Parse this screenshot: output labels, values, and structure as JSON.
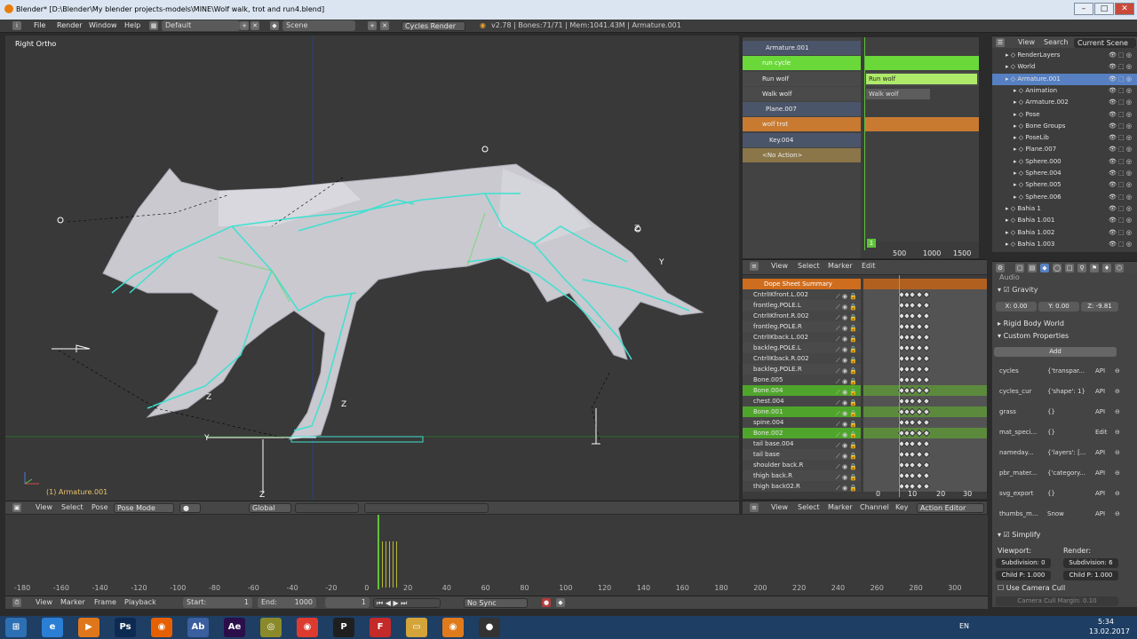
{
  "window": {
    "title": "Blender* [D:\\Blender\\My blender projects-models\\MINE\\Wolf walk, trot and run4.blend]"
  },
  "infobar": {
    "menus": [
      "File",
      "Render",
      "Window",
      "Help"
    ],
    "screen_layout": "Default",
    "scene": "Scene",
    "engine": "Cycles Render",
    "stats": "v2.78 | Bones:71/71 | Mem:1041.43M | Armature.001"
  },
  "viewport": {
    "view_name": "Right Ortho",
    "active_object": "(1) Armature.001",
    "axis_labels": [
      "Y",
      "Z",
      "Z",
      "Z",
      "Y",
      "Z"
    ],
    "header": {
      "menus": [
        "View",
        "Select",
        "Pose"
      ],
      "mode": "Pose Mode",
      "orientation": "Global"
    }
  },
  "nla": {
    "tracks": [
      {
        "name": "Armature.001",
        "type": "object"
      },
      {
        "name": "run cycle",
        "type": "active"
      },
      {
        "name": "Run wolf",
        "type": "track"
      },
      {
        "name": "Walk wolf",
        "type": "track"
      },
      {
        "name": "Plane.007",
        "type": "object"
      },
      {
        "name": "wolf trot",
        "type": "action"
      },
      {
        "name": "Key.004",
        "type": "object"
      },
      {
        "name": "<No Action>",
        "type": "noaction"
      }
    ],
    "strip_labels": [
      "Run wolf",
      "Walk wolf"
    ],
    "frame_indicator": "1",
    "ruler": [
      "500",
      "1000",
      "1500"
    ]
  },
  "dopesheet": {
    "header_menus": [
      "View",
      "Select",
      "Marker",
      "Edit"
    ],
    "summary": "Dope Sheet Summary",
    "channels": [
      {
        "name": "CntrlIKfront.L.002",
        "selected": false
      },
      {
        "name": "frontleg.POLE.L",
        "selected": false
      },
      {
        "name": "CntrlIKfront.R.002",
        "selected": false
      },
      {
        "name": "frontleg.POLE.R",
        "selected": false
      },
      {
        "name": "CntrlIKback.L.002",
        "selected": false
      },
      {
        "name": "backleg.POLE.L",
        "selected": false
      },
      {
        "name": "CntrlIKback.R.002",
        "selected": false
      },
      {
        "name": "backleg.POLE.R",
        "selected": false
      },
      {
        "name": "Bone.005",
        "selected": false
      },
      {
        "name": "Bone.004",
        "selected": true
      },
      {
        "name": "chest.004",
        "selected": false
      },
      {
        "name": "Bone.001",
        "selected": true
      },
      {
        "name": "spine.004",
        "selected": false
      },
      {
        "name": "Bone.002",
        "selected": true
      },
      {
        "name": "tail base.004",
        "selected": false
      },
      {
        "name": "tail base",
        "selected": false
      },
      {
        "name": "shoulder back.R",
        "selected": false
      },
      {
        "name": "thigh back.R",
        "selected": false
      },
      {
        "name": "thigh back02.R",
        "selected": false
      }
    ],
    "ruler": [
      "0",
      "10",
      "20",
      "30"
    ],
    "footer": {
      "menus": [
        "View",
        "Select",
        "Marker",
        "Channel",
        "Key"
      ],
      "editor": "Action Editor"
    }
  },
  "outliner": {
    "tabs": [
      "View",
      "Search",
      "Current Scene"
    ],
    "items": [
      {
        "name": "RenderLayers",
        "indent": 1
      },
      {
        "name": "World",
        "indent": 1
      },
      {
        "name": "Armature.001",
        "indent": 1,
        "active": true
      },
      {
        "name": "Animation",
        "indent": 2
      },
      {
        "name": "Armature.002",
        "indent": 2
      },
      {
        "name": "Pose",
        "indent": 2
      },
      {
        "name": "Bone Groups",
        "indent": 2
      },
      {
        "name": "PoseLib",
        "indent": 2
      },
      {
        "name": "Plane.007",
        "indent": 2
      },
      {
        "name": "Sphere.000",
        "indent": 2
      },
      {
        "name": "Sphere.004",
        "indent": 2
      },
      {
        "name": "Sphere.005",
        "indent": 2
      },
      {
        "name": "Sphere.006",
        "indent": 2
      },
      {
        "name": "Bahia 1",
        "indent": 1
      },
      {
        "name": "Bahia 1.001",
        "indent": 1
      },
      {
        "name": "Bahia 1.002",
        "indent": 1
      },
      {
        "name": "Bahia 1.003",
        "indent": 1
      }
    ]
  },
  "properties": {
    "audio": "Audio",
    "gravity": {
      "label": "Gravity",
      "x": "X: 0.00",
      "y": "Y: 0.00",
      "z": "Z: -9.81"
    },
    "rigid_body_world": "Rigid Body World",
    "custom_properties": "Custom Properties",
    "add": "Add",
    "props": [
      {
        "name": "cycles",
        "value": "{'transpar...",
        "api": "API"
      },
      {
        "name": "cycles_cur",
        "value": "{'shape': 1}",
        "api": "API"
      },
      {
        "name": "grass",
        "value": "{}",
        "api": "API"
      },
      {
        "name": "mat_speci...",
        "value": "{}",
        "api": "Edit"
      },
      {
        "name": "nameday...",
        "value": "{'layers': [...",
        "api": "API"
      },
      {
        "name": "pbr_mater...",
        "value": "{'category...",
        "api": "API"
      },
      {
        "name": "svg_export",
        "value": "{}",
        "api": "API"
      },
      {
        "name": "thumbs_m...",
        "value": "Snow",
        "api": "API"
      }
    ],
    "simplify": "Simplify",
    "viewport_label": "Viewport:",
    "render_label": "Render:",
    "subdivision_v": "Subdivision: 0",
    "subdivision_r": "Subdivision: 6",
    "childp_v": "Child P: 1.000",
    "childp_r": "Child P: 1.000",
    "use_camera_cull": "Use Camera Cull",
    "camera_cull_margin": "Camera Cull Margin: 0.10"
  },
  "timeline": {
    "ruler": [
      "-180",
      "-160",
      "-140",
      "-120",
      "-100",
      "-80",
      "-60",
      "-40",
      "-20",
      "0",
      "20",
      "40",
      "60",
      "80",
      "100",
      "120",
      "140",
      "160",
      "180",
      "200",
      "220",
      "240",
      "260",
      "280",
      "300"
    ],
    "footer": {
      "menus": [
        "View",
        "Marker",
        "Frame",
        "Playback"
      ],
      "start": "Start:",
      "start_val": "1",
      "end": "End:",
      "end_val": "1000",
      "current": "1",
      "sync": "No Sync"
    }
  },
  "taskbar": {
    "lang": "EN",
    "time": "5:34",
    "date": "13.02.2017",
    "apps": [
      "start",
      "ie",
      "media",
      "Ps",
      "firefox",
      "Ab",
      "Ae",
      "chrome-alt",
      "chrome",
      "P",
      "F",
      "folder",
      "blender",
      "obs"
    ]
  }
}
